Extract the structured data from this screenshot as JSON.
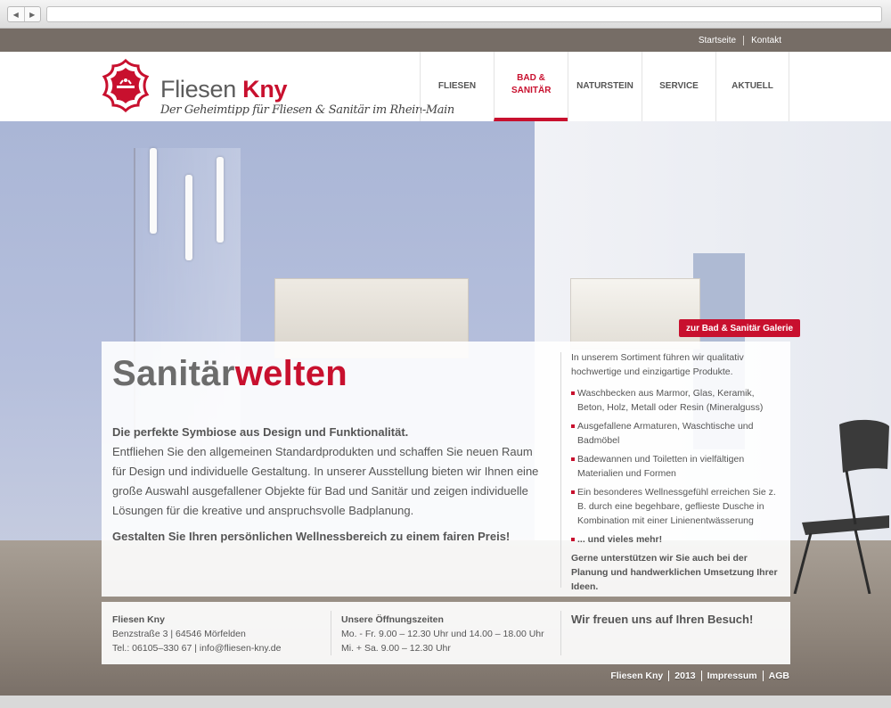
{
  "browser": {
    "back_icon": "back-arrow-icon",
    "forward_icon": "forward-arrow-icon",
    "address": ""
  },
  "toplinks": [
    "Startseite",
    "Kontakt"
  ],
  "brand": {
    "name_light": "Fliesen ",
    "name_bold": "Kny",
    "tagline": "Der Geheimtipp für Fliesen & Sanitär im Rhein-Main",
    "emblem_icon": "ornament-logo-icon"
  },
  "menu": [
    {
      "label": "FLIESEN",
      "active": false
    },
    {
      "label": "BAD & SANITÄR",
      "active": true
    },
    {
      "label": "NATURSTEIN",
      "active": false
    },
    {
      "label": "SERVICE",
      "active": false
    },
    {
      "label": "AKTUELL",
      "active": false
    }
  ],
  "gallery_button": "zur Bad & Sanitär Galerie",
  "content": {
    "title_plain": "Sanitär",
    "title_accent": "welten",
    "lead_bold": "Die perfekte Symbiose aus Design und Funktionalität.",
    "lead_text": "Entfliehen Sie den allgemeinen Standardprodukten und schaffen Sie neuen Raum für Design und individuelle Gestaltung. In unserer Ausstellung bieten wir Ihnen eine große Auswahl ausgefallener Objekte für Bad und Sanitär und zeigen individuelle Lösungen für die kreative und anspruchsvolle Badplanung.",
    "claim": "Gestalten Sie Ihren persönlichen Wellnessbereich zu einem fairen Preis!",
    "side_intro": "In unserem Sortiment führen wir qualitativ hochwertige und einzigartige Produkte.",
    "side_items": [
      "Waschbecken aus Marmor, Glas, Keramik, Beton, Holz, Metall oder Resin (Mineralguss)",
      "Ausgefallene Armaturen, Waschtische und Badmöbel",
      "Badewannen und Toiletten in vielfältigen Materialien und Formen",
      "Ein besonderes Wellnessgefühl erreichen Sie z. B. durch eine begehbare, geflieste Dusche in Kombination mit einer Linienentwässerung",
      "... und vieles mehr!"
    ],
    "side_outro": "Gerne unterstützen wir Sie auch bei der Planung und handwerklichen Umsetzung Ihrer Ideen."
  },
  "footer": {
    "company": "Fliesen Kny",
    "address": "Benzstraße 3 | 64546 Mörfelden",
    "contact": "Tel.: 06105–330 67 | info@fliesen-kny.de",
    "hours_title": "Unsere Öffnungszeiten",
    "hours_weekday": "Mo. - Fr. 9.00 – 12.30 Uhr und 14.00 – 18.00 Uhr",
    "hours_saturday": "Mi. + Sa. 9.00 – 12.30 Uhr",
    "welcome": "Wir freuen uns auf Ihren Besuch!"
  },
  "bottom_links": [
    "Fliesen Kny",
    "2013",
    "Impressum",
    "AGB"
  ],
  "colors": {
    "accent": "#c8102e",
    "topbar": "#766d66",
    "text": "#555555"
  }
}
